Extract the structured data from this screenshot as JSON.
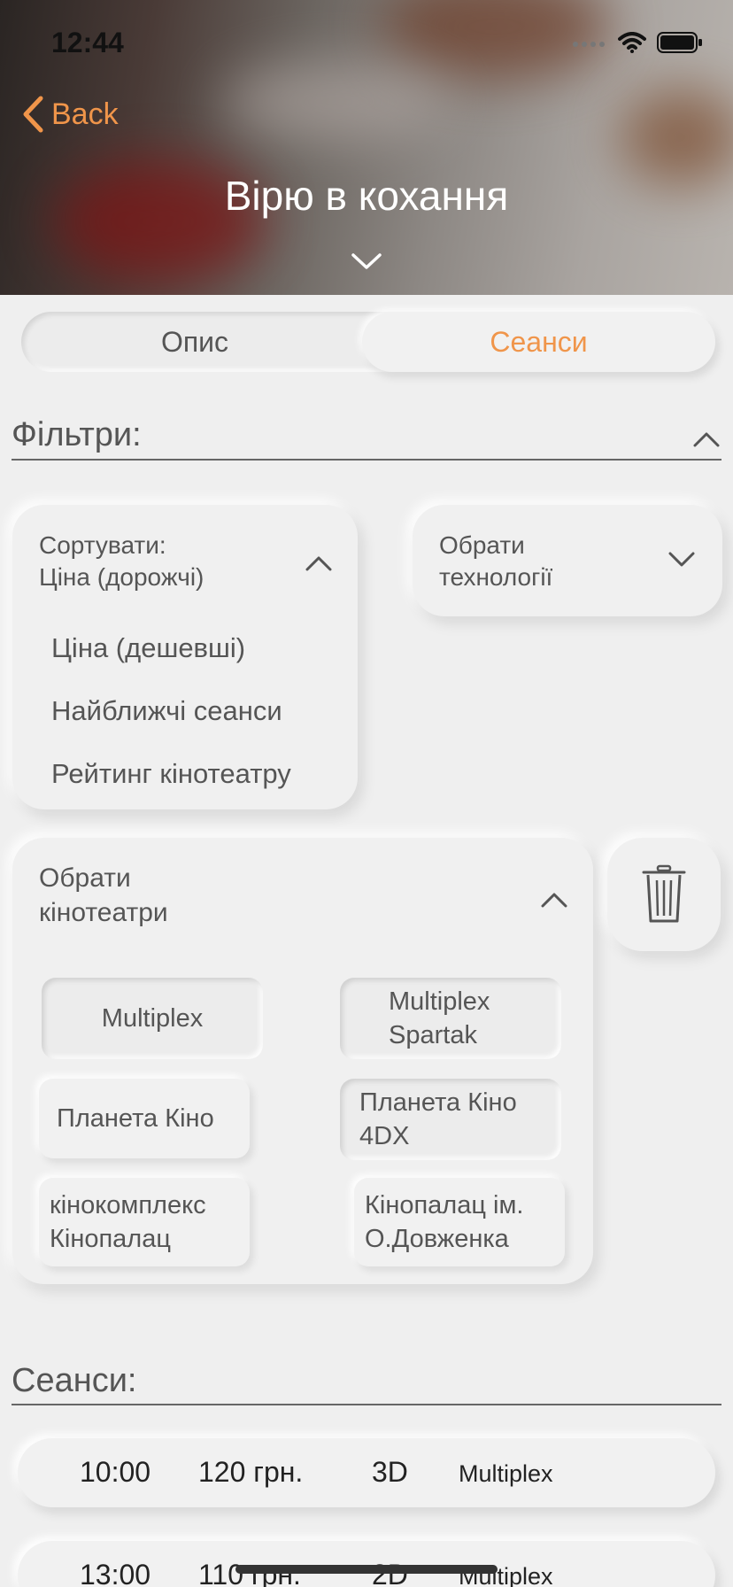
{
  "status": {
    "time": "12:44"
  },
  "nav": {
    "back_label": "Back",
    "title": "Вірю в кохання"
  },
  "tabs": [
    {
      "label": "Опис"
    },
    {
      "label": "Сеанси"
    }
  ],
  "filters": {
    "title": "Фільтри:",
    "sort": {
      "label_line1": "Сортувати:",
      "label_line2": "Ціна (дорожчі)",
      "options": [
        "Ціна (дешевші)",
        "Найближчі сеанси",
        "Рейтинг кінотеатру"
      ]
    },
    "technology": {
      "label_line1": "Обрати",
      "label_line2": "технології"
    },
    "cinemas": {
      "label_line1": "Обрати",
      "label_line2": "кінотеатри",
      "items": [
        {
          "line1": "Multiplex",
          "line2": ""
        },
        {
          "line1": "Multiplex",
          "line2": "Spartak"
        },
        {
          "line1": "Планета Кіно",
          "line2": ""
        },
        {
          "line1": "Планета Кіно",
          "line2": "4DX"
        },
        {
          "line1": "кінокомплекс",
          "line2": "Кінопалац"
        },
        {
          "line1": "Кінопалац ім.",
          "line2": "О.Довженка"
        }
      ]
    }
  },
  "sessions": {
    "title": "Сеанси:",
    "rows": [
      {
        "time": "10:00",
        "price": "120 грн.",
        "format": "3D",
        "cinema": "Multiplex"
      },
      {
        "time": "13:00",
        "price": "110 грн.",
        "format": "2D",
        "cinema": "Multiplex"
      }
    ]
  },
  "colors": {
    "accent": "#f0954a",
    "background": "#efefef"
  },
  "icons": [
    "chevron-left-icon",
    "chevron-down-icon",
    "chevron-up-icon",
    "trash-icon",
    "wifi-icon",
    "battery-icon",
    "signal-icon"
  ]
}
